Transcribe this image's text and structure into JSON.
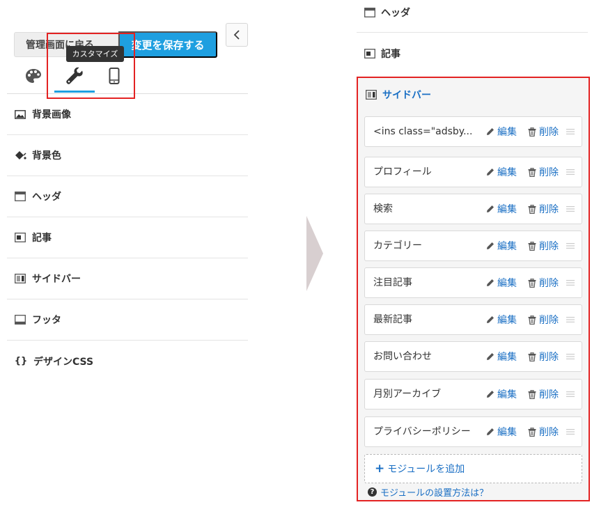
{
  "left": {
    "back_button": "管理画面に戻る",
    "save_button": "変更を保存する",
    "tooltip": "カスタマイズ",
    "tabs": [
      {
        "icon": "palette-icon"
      },
      {
        "icon": "wrench-icon",
        "active": true
      },
      {
        "icon": "mobile-icon"
      }
    ],
    "menu": [
      {
        "label": "背景画像",
        "icon": "image-icon"
      },
      {
        "label": "背景色",
        "icon": "paint-bucket-icon"
      },
      {
        "label": "ヘッダ",
        "icon": "header-layout-icon"
      },
      {
        "label": "記事",
        "icon": "article-layout-icon"
      },
      {
        "label": "サイドバー",
        "icon": "sidebar-layout-icon"
      },
      {
        "label": "フッタ",
        "icon": "footer-layout-icon"
      },
      {
        "label": "デザインCSS",
        "icon": "code-braces-icon"
      }
    ]
  },
  "right": {
    "sections": [
      {
        "label": "ヘッダ"
      },
      {
        "label": "記事"
      }
    ],
    "sidebar": {
      "label": "サイドバー",
      "edit_label": "編集",
      "delete_label": "削除",
      "modules": [
        {
          "name": "<ins class=\"adsby..."
        },
        {
          "name": "プロフィール"
        },
        {
          "name": "検索"
        },
        {
          "name": "カテゴリー"
        },
        {
          "name": "注目記事"
        },
        {
          "name": "最新記事"
        },
        {
          "name": "お問い合わせ"
        },
        {
          "name": "月別アーカイブ"
        },
        {
          "name": "プライバシーポリシー"
        }
      ],
      "add_label": "モジュールを追加",
      "help_label": "モジュールの設置方法は？"
    }
  },
  "colors": {
    "accent": "#1e9fe0",
    "link": "#1a6fc4",
    "highlight": "#e32222"
  }
}
